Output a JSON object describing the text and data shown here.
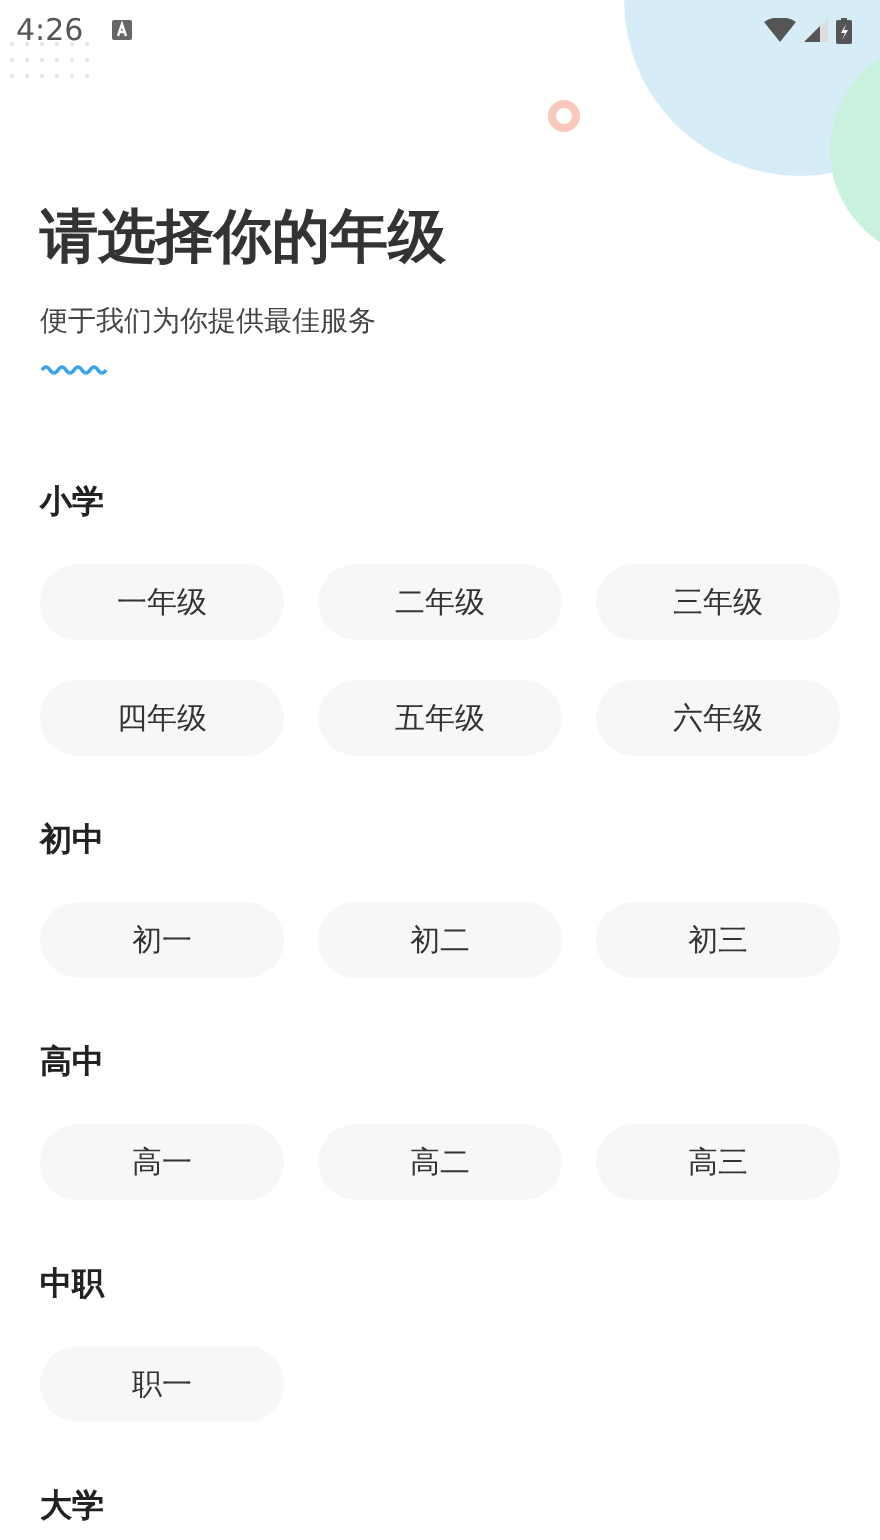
{
  "status_bar": {
    "time": "4:26"
  },
  "header": {
    "title": "请选择你的年级",
    "subtitle": "便于我们为你提供最佳服务"
  },
  "sections": [
    {
      "title": "小学",
      "grades": [
        {
          "label": "一年级",
          "selected": false
        },
        {
          "label": "二年级",
          "selected": false
        },
        {
          "label": "三年级",
          "selected": false
        },
        {
          "label": "四年级",
          "selected": false
        },
        {
          "label": "五年级",
          "selected": false
        },
        {
          "label": "六年级",
          "selected": false
        }
      ]
    },
    {
      "title": "初中",
      "grades": [
        {
          "label": "初一",
          "selected": false
        },
        {
          "label": "初二",
          "selected": false
        },
        {
          "label": "初三",
          "selected": false
        }
      ]
    },
    {
      "title": "高中",
      "grades": [
        {
          "label": "高一",
          "selected": false
        },
        {
          "label": "高二",
          "selected": false
        },
        {
          "label": "高三",
          "selected": false
        }
      ]
    },
    {
      "title": "中职",
      "grades": [
        {
          "label": "职一",
          "selected": false
        }
      ]
    },
    {
      "title": "大学"
    }
  ]
}
